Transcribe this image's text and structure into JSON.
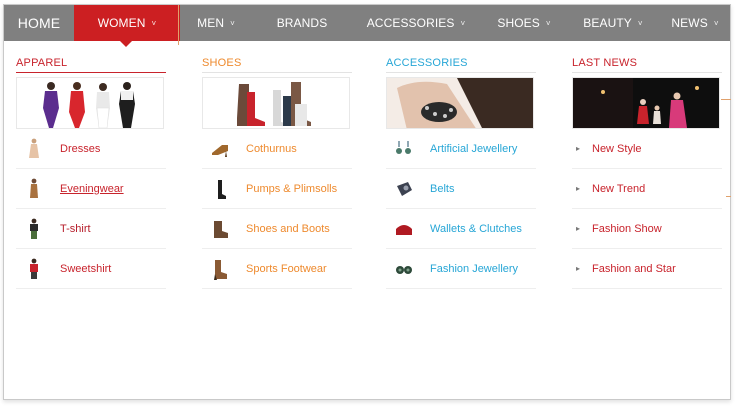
{
  "nav": {
    "home": "HOME",
    "women": "WOMEN",
    "men": "MEN",
    "brands": "BRANDS",
    "accessories": "ACCESSORIES",
    "shoes": "SHOES",
    "beauty": "BEAUTY",
    "news": "NEWS",
    "active_color": "#cc1f22",
    "bar_color": "#808080"
  },
  "menu": {
    "apparel": {
      "title": "APPAREL",
      "color": "#c8232c",
      "items": [
        {
          "label": "Dresses",
          "icon": "dress-icon"
        },
        {
          "label": "Eveningwear",
          "icon": "evening-dress-icon"
        },
        {
          "label": "T-shirt",
          "icon": "tshirt-icon"
        },
        {
          "label": "Sweetshirt",
          "icon": "sweatshirt-icon"
        }
      ]
    },
    "shoes": {
      "title": "SHOES",
      "color": "#ee8a2e",
      "items": [
        {
          "label": "Cothurnus",
          "icon": "sandal-icon"
        },
        {
          "label": "Pumps & Plimsolls",
          "icon": "pump-icon"
        },
        {
          "label": "Shoes and Boots",
          "icon": "boot-icon"
        },
        {
          "label": "Sports Footwear",
          "icon": "sport-shoe-icon"
        }
      ]
    },
    "accessories": {
      "title": "ACCESSORIES",
      "color": "#27a6d6",
      "items": [
        {
          "label": "Artificial Jewellery",
          "icon": "earrings-icon"
        },
        {
          "label": "Belts",
          "icon": "belt-icon"
        },
        {
          "label": "Wallets & Clutches",
          "icon": "clutch-icon"
        },
        {
          "label": "Fashion Jewellery",
          "icon": "jewellery-icon"
        }
      ]
    },
    "news": {
      "title": "LAST NEWS",
      "color": "#c8232c",
      "items": [
        {
          "label": "New Style",
          "icon": "arrow-right-icon"
        },
        {
          "label": "New Trend",
          "icon": "arrow-right-icon"
        },
        {
          "label": "Fashion Show",
          "icon": "arrow-right-icon"
        },
        {
          "label": "Fashion and Star",
          "icon": "arrow-right-icon"
        }
      ]
    }
  }
}
